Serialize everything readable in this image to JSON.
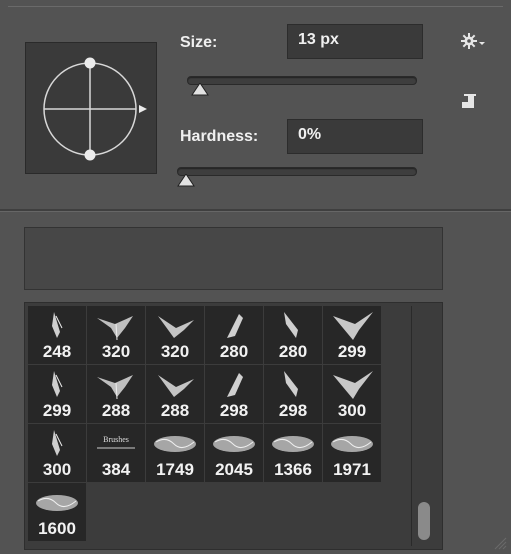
{
  "brush_panel": {
    "size_label": "Size:",
    "size_value": "13 px",
    "size_slider_fraction": 0.08,
    "hardness_label": "Hardness:",
    "hardness_value": "0%",
    "hardness_slider_fraction": 0.0
  },
  "brush_name": "",
  "brushes": [
    {
      "size": "248",
      "icon": "bird-brush-icon"
    },
    {
      "size": "320",
      "icon": "bird-brush-icon"
    },
    {
      "size": "320",
      "icon": "bird-brush-icon"
    },
    {
      "size": "280",
      "icon": "bird-brush-icon"
    },
    {
      "size": "280",
      "icon": "bird-brush-icon"
    },
    {
      "size": "299",
      "icon": "bird-brush-icon"
    },
    {
      "size": "299",
      "icon": "bird-brush-icon"
    },
    {
      "size": "288",
      "icon": "bird-brush-icon"
    },
    {
      "size": "288",
      "icon": "bird-brush-icon"
    },
    {
      "size": "298",
      "icon": "bird-brush-icon"
    },
    {
      "size": "298",
      "icon": "bird-brush-icon"
    },
    {
      "size": "300",
      "icon": "bird-brush-icon"
    },
    {
      "size": "300",
      "icon": "bird-brush-icon"
    },
    {
      "size": "384",
      "icon": "text-brush-icon"
    },
    {
      "size": "1749",
      "icon": "texture-brush-icon"
    },
    {
      "size": "2045",
      "icon": "texture-brush-icon"
    },
    {
      "size": "1366",
      "icon": "texture-brush-icon"
    },
    {
      "size": "1971",
      "icon": "texture-brush-icon"
    },
    {
      "size": "1600",
      "icon": "texture-brush-icon"
    }
  ],
  "scroll_position_fraction": 1.0,
  "colors": {
    "panel_bg": "#535353",
    "field_bg": "#3a3a3a",
    "cell_bg": "#272727",
    "text": "#f0f0f0"
  }
}
